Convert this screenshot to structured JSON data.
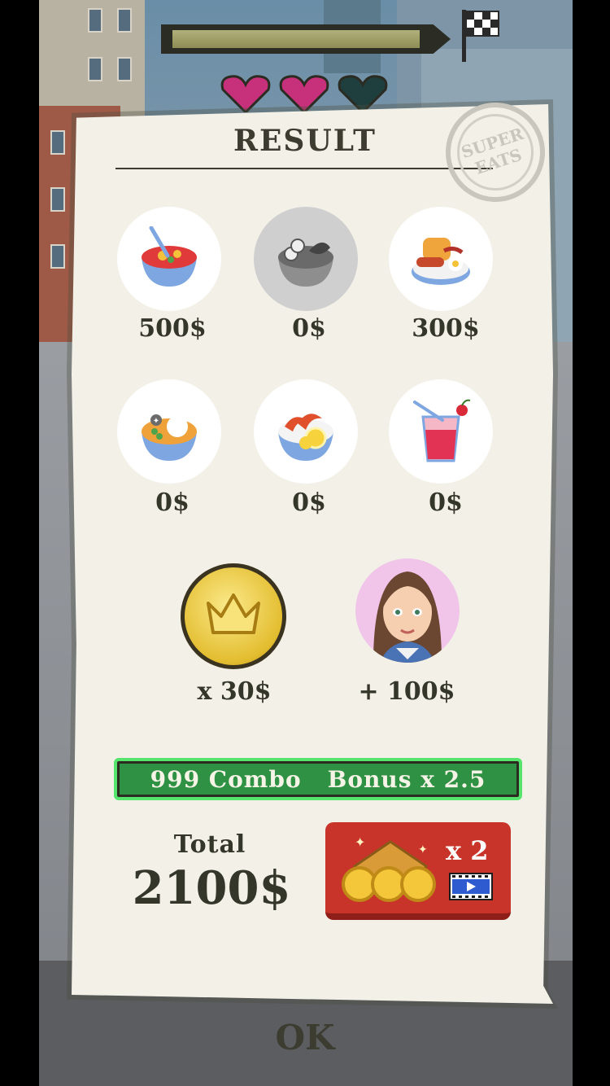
{
  "hud": {
    "progress": 0.95,
    "lives": {
      "filled": 2,
      "total": 3
    },
    "filled_heart_color": "#c7307a",
    "empty_heart_color": "#1f3f3e"
  },
  "result": {
    "title": "RESULT",
    "stamp_top": "SUPER",
    "stamp_bottom": "EATS",
    "foods": [
      {
        "icon": "soup-bowl-icon",
        "price": "500$",
        "served": true
      },
      {
        "icon": "salad-bowl-icon",
        "price": "0$",
        "served": false
      },
      {
        "icon": "breakfast-plate-icon",
        "price": "300$",
        "served": true
      },
      {
        "icon": "curry-bowl-icon",
        "price": "0$",
        "served": true
      },
      {
        "icon": "shrimp-plate-icon",
        "price": "0$",
        "served": true
      },
      {
        "icon": "juice-cup-icon",
        "price": "0$",
        "served": true
      }
    ],
    "crown_coin_multiplier": "x 30$",
    "customer_bonus": "+ 100$",
    "combo_text": "999 Combo",
    "bonus_text": "Bonus x 2.5",
    "total_label": "Total",
    "total_value": "2100$",
    "double_multiplier": "x 2",
    "ok_label": "OK"
  },
  "colors": {
    "card": "#f3f1e7",
    "text_dark": "#35362a",
    "combo_green": "#2f9143",
    "double_red": "#c9342a"
  }
}
